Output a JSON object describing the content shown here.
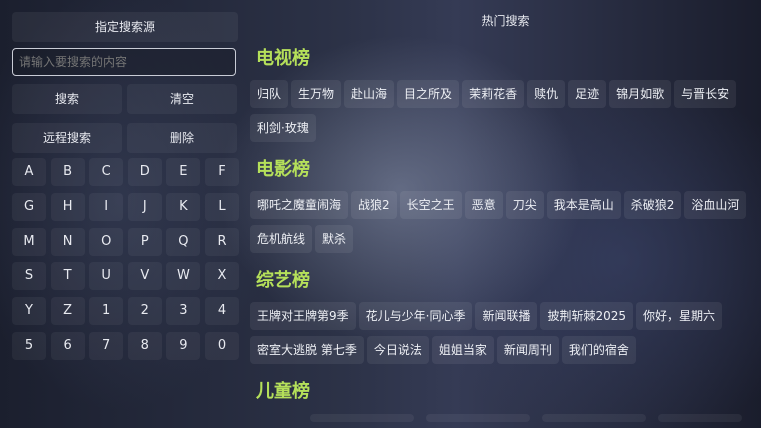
{
  "left": {
    "source_button": "指定搜索源",
    "search_placeholder": "请输入要搜索的内容",
    "search_label": "搜索",
    "clear_label": "清空",
    "remote_label": "远程搜索",
    "delete_label": "删除",
    "keys": [
      "A",
      "B",
      "C",
      "D",
      "E",
      "F",
      "G",
      "H",
      "I",
      "J",
      "K",
      "L",
      "M",
      "N",
      "O",
      "P",
      "Q",
      "R",
      "S",
      "T",
      "U",
      "V",
      "W",
      "X",
      "Y",
      "Z",
      "1",
      "2",
      "3",
      "4",
      "5",
      "6",
      "7",
      "8",
      "9",
      "0"
    ]
  },
  "hot": {
    "title": "热门搜索",
    "sections": [
      {
        "title": "电视榜",
        "rows": [
          [
            "归队",
            "生万物",
            "赴山海",
            "目之所及",
            "茉莉花香",
            "赎仇",
            "足迹",
            "锦月如歌",
            "与晋长安"
          ],
          [
            "利剑·玫瑰"
          ]
        ]
      },
      {
        "title": "电影榜",
        "rows": [
          [
            "哪吒之魔童闹海",
            "战狼2",
            "长空之王",
            "恶意",
            "刀尖",
            "我本是高山",
            "杀破狼2",
            "浴血山河"
          ],
          [
            "危机航线",
            "默杀"
          ]
        ]
      },
      {
        "title": "综艺榜",
        "rows": [
          [
            "王牌对王牌第9季",
            "花儿与少年·同心季",
            "新闻联播",
            "披荆斩棘2025",
            "你好，星期六"
          ],
          [
            "密室大逃脱 第七季",
            "今日说法",
            "姐姐当家",
            "新闻周刊",
            "我们的宿舍"
          ]
        ]
      },
      {
        "title": "儿童榜",
        "rows": []
      }
    ]
  },
  "colors": {
    "section_title": "#b5e05a",
    "input_border": "#c9ccd6"
  }
}
